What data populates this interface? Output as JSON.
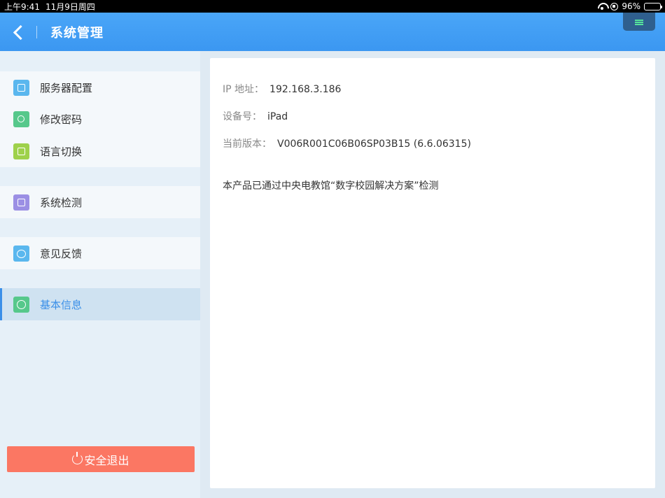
{
  "statusbar": {
    "time": "上午9:41",
    "date": "11月9日周四",
    "battery": "96%",
    "battery_level": 0.96
  },
  "header": {
    "title": "系统管理"
  },
  "sidebar": {
    "items": [
      {
        "label": "服务器配置",
        "icon": "ip-icon",
        "color": "#5ab7ee"
      },
      {
        "label": "修改密码",
        "icon": "key-icon",
        "color": "#56c88b"
      },
      {
        "label": "语言切换",
        "icon": "language-icon",
        "color": "#9ed14b"
      },
      {
        "label": "系统检测",
        "icon": "monitor-icon",
        "color": "#9b8fe4"
      },
      {
        "label": "意见反馈",
        "icon": "feedback-icon",
        "color": "#5ab7ee"
      },
      {
        "label": "基本信息",
        "icon": "info-icon",
        "color": "#56c88b",
        "active": true
      }
    ],
    "logout_label": "安全退出"
  },
  "info": {
    "ip_label": "IP 地址：",
    "ip_value": "192.168.3.186",
    "device_label": "设备号：",
    "device_value": "iPad",
    "version_label": "当前版本：",
    "version_value": "V006R001C06B06SP03B15 (6.6.06315)",
    "note": "本产品已通过中央电教馆“数字校园解决方案”检测"
  },
  "colors": {
    "accent": "#3a8fe8",
    "logout": "#fb7763",
    "header": "#4aa6f8"
  }
}
